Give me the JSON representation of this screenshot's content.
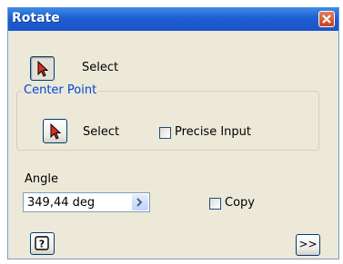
{
  "window": {
    "title": "Rotate"
  },
  "select_row": {
    "label": "Select"
  },
  "center_point": {
    "group_label": "Center Point",
    "select_label": "Select",
    "precise_input_label": "Precise Input",
    "precise_input_checked": false
  },
  "angle": {
    "label": "Angle",
    "value": "349,44 deg"
  },
  "copy": {
    "label": "Copy",
    "checked": false
  },
  "footer": {
    "expand_label": ">>"
  },
  "icons": {
    "close": "close-icon",
    "select": "arrow-cursor-icon",
    "help": "help-icon",
    "spin": "chevron-right-icon"
  },
  "colors": {
    "title_bar": "#1d5fd1",
    "dialog_bg": "#ece9d8",
    "group_label": "#0046d5",
    "close_button": "#c8401f"
  }
}
